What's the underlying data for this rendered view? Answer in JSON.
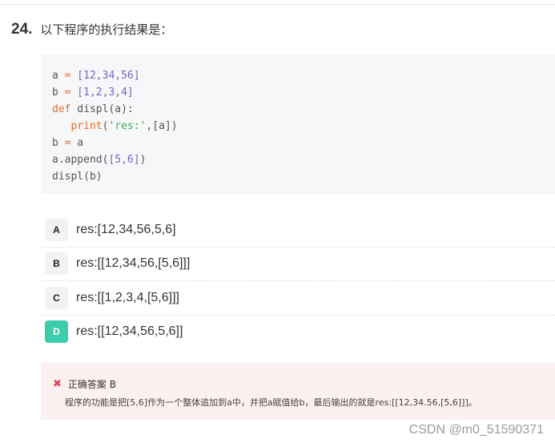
{
  "question": {
    "number": "24.",
    "text": "以下程序的执行结果是："
  },
  "code_lines": [
    [
      {
        "t": "a ",
        "c": "f"
      },
      {
        "t": "=",
        "c": "k"
      },
      {
        "t": " [12,34,56]",
        "c": "n"
      }
    ],
    [
      {
        "t": "b ",
        "c": "f"
      },
      {
        "t": "=",
        "c": "k"
      },
      {
        "t": " [1,2,3,4]",
        "c": "n"
      }
    ],
    [
      {
        "t": "def",
        "c": "k"
      },
      {
        "t": " displ(",
        "c": "f"
      },
      {
        "t": "a",
        "c": "f"
      },
      {
        "t": "):",
        "c": "f"
      }
    ],
    [
      {
        "t": "   ",
        "c": "f"
      },
      {
        "t": "print",
        "c": "k"
      },
      {
        "t": "(",
        "c": "f"
      },
      {
        "t": "'res:'",
        "c": "s"
      },
      {
        "t": ",[a])",
        "c": "f"
      }
    ],
    [
      {
        "t": "b ",
        "c": "f"
      },
      {
        "t": "=",
        "c": "k"
      },
      {
        "t": " a",
        "c": "f"
      }
    ],
    [
      {
        "t": "a.append(",
        "c": "f"
      },
      {
        "t": "[5,6]",
        "c": "n"
      },
      {
        "t": ")",
        "c": "f"
      }
    ],
    [
      {
        "t": "displ(b)",
        "c": "f"
      }
    ]
  ],
  "options": [
    {
      "label": "A",
      "text": "res:[12,34,56,5,6]",
      "correct": false
    },
    {
      "label": "B",
      "text": "res:[[12,34,56,[5,6]]]",
      "correct": false
    },
    {
      "label": "C",
      "text": "res:[[1,2,3,4,[5,6]]]",
      "correct": false
    },
    {
      "label": "D",
      "text": "res:[[12,34,56,5,6]]",
      "correct": true
    }
  ],
  "answer": {
    "icon": "x-icon",
    "icon_glyph": "✖",
    "title": "正确答案 B",
    "explanation": "程序的功能是把[5,6]作为一个整体追加到a中，并把a赋值给b，最后输出的就是res:[[12,34.56,[5,6]]]。"
  },
  "watermark": "CSDN @m0_51590371",
  "colors": {
    "keyword": "#e46d24",
    "number": "#7a64c4",
    "string": "#3eae5e",
    "correct_badge": "#3ccdad",
    "answer_bg": "#fdf0f0",
    "x_icon": "#e0475b"
  }
}
